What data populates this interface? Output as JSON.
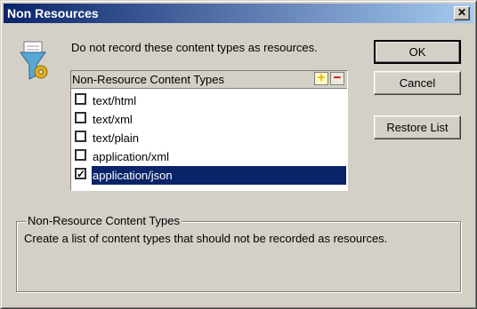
{
  "window": {
    "title": "Non Resources",
    "close_glyph": "✕"
  },
  "icon": {
    "name": "filter-gear-icon"
  },
  "description": "Do not record these content types as resources.",
  "list": {
    "header": "Non-Resource Content Types",
    "add_glyph": "+",
    "remove_glyph": "−",
    "items": [
      {
        "label": "text/html",
        "checked": false,
        "selected": false
      },
      {
        "label": "text/xml",
        "checked": false,
        "selected": false
      },
      {
        "label": "text/plain",
        "checked": false,
        "selected": false
      },
      {
        "label": "application/xml",
        "checked": false,
        "selected": false
      },
      {
        "label": "application/json",
        "checked": true,
        "selected": true
      }
    ]
  },
  "buttons": {
    "ok": "OK",
    "cancel": "Cancel",
    "restore": "Restore List"
  },
  "help": {
    "title": "Non-Resource Content Types",
    "text": "Create a list of content types that should not be recorded as resources."
  }
}
